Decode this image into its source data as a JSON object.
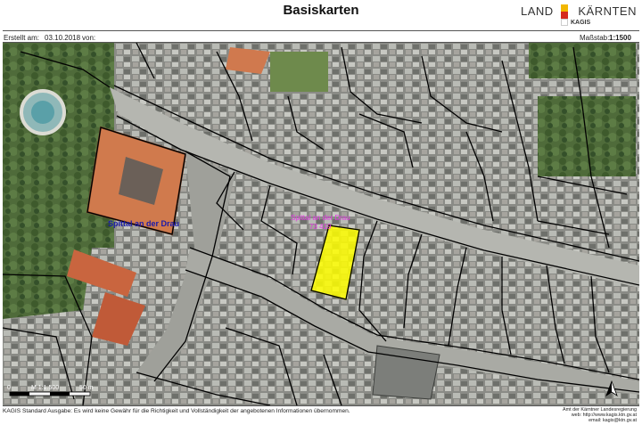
{
  "header": {
    "title": "Basiskarten",
    "created_label": "Erstellt am:",
    "created_value": "03.10.2018",
    "from_label": "von:",
    "scale_label": "Maßstab:",
    "scale_value": "1:1500",
    "logo_land": "LAND",
    "logo_kaernten": "KÄRNTEN",
    "logo_kagis": "KAGIS",
    "flag_colors": [
      "#f2b700",
      "#d62b1e",
      "#ffffff"
    ]
  },
  "map": {
    "town_label": "Spittal an der Drau",
    "parcel_label_line1": "Spittal an der Drau",
    "parcel_label_line2": "73 419",
    "highlight_color": "#ffff00",
    "town_label_color": "#1a1aa8",
    "parcel_label_color": "#e535e5",
    "scalebar": {
      "zero": "0",
      "text": "M 1:1.500",
      "end": "50 m"
    },
    "north_arrow": "north-arrow"
  },
  "footer": {
    "disclaimer": "KAGIS Standard Ausgabe: Es wird keine Gewähr für die Richtigkeit und Vollständigkeit der angebotenen Informationen übernommen.",
    "imprint_line1": "Amt der Kärntner Landesregierung",
    "imprint_line2": "web: http://www.kagis.ktn.gv.at",
    "imprint_line3": "email: kagis@ktn.gv.at"
  }
}
